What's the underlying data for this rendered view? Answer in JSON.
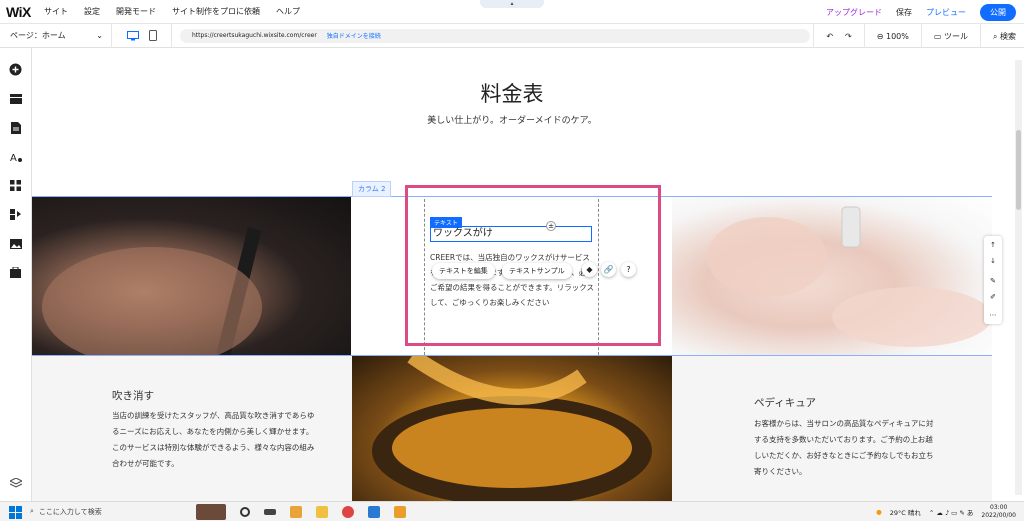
{
  "app": {
    "logo": "WiX",
    "menu": [
      "サイト",
      "設定",
      "開発モード",
      "サイト制作をプロに依頼",
      "ヘルプ"
    ],
    "upgrade_label": "アップグレード",
    "save_label": "保存",
    "preview_label": "プレビュー",
    "publish_label": "公開"
  },
  "toolbar": {
    "page_select": "ページ：ホーム",
    "url": "https://creertsukaguchi.wixsite.com/creer",
    "connect_domain": "独自ドメインを接続",
    "zoom": "100%",
    "tools_label": "ツール",
    "search_label": "検索"
  },
  "canvas": {
    "title": "料金表",
    "subtitle": "美しい仕上がり。オーダーメイドのケア。",
    "column_tag": "カラム 2",
    "text_tag": "テキスト",
    "selected_text": "ワックスがけ",
    "body_text": "CREERでは、当店独自のワックスがけサービスをご用意しております。ご利用いただけば、必ずご希望の結果を得ることができます。リラックスして、ごゆっくりお楽しみください",
    "edit_text_button": "テキストを編集",
    "text_sample_button": "テキストサンプル",
    "left_card_title": "吹き消す",
    "left_card_text": "当店の訓練を受けたスタッフが、高品質な吹き消すであらゆるニーズにお応えし、あなたを内側から美しく輝かせます。このサービスは特別な体験ができるよう、様々な内容の組み合わせが可能です。",
    "right_card_title": "ペディキュア",
    "right_card_text": "お客様からは、当サロンの高品質なペディキュアに対する支持を多数いただいております。ご予約の上お越しいただくか、お好きなときにご予約なしでもお立ち寄りください。"
  },
  "taskbar": {
    "search_placeholder": "ここに入力して検索",
    "weather": "29°C 晴れ",
    "time": "03:00",
    "date": "2022/00/00"
  },
  "colors": {
    "accent": "#116dff",
    "upgrade": "#9a27d5",
    "selection": "#dc4b86"
  }
}
